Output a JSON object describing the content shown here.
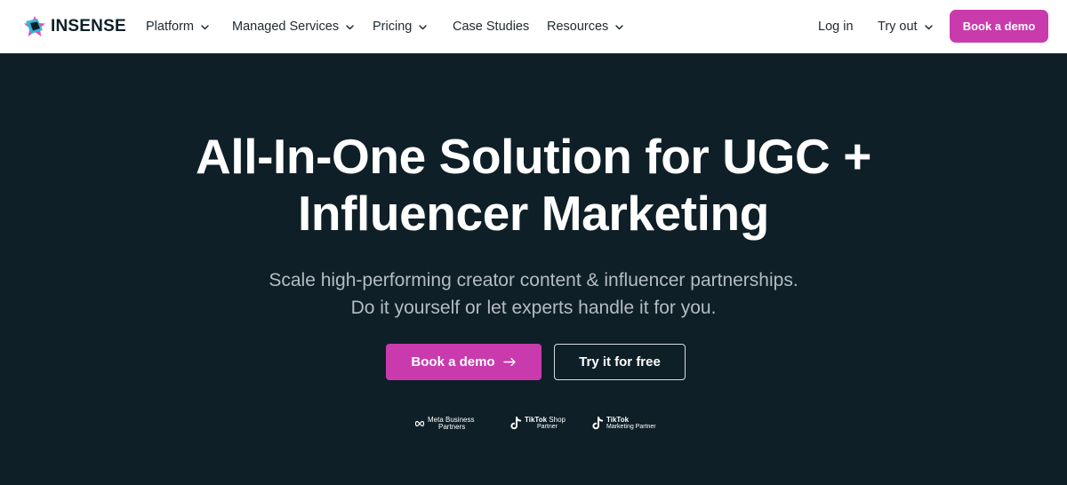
{
  "brand": {
    "name": "INSENSE",
    "colors": {
      "accent": "#c93aad",
      "dark_bg": "#0f1f27",
      "nav_bg": "#ffffff",
      "text_dark": "#1c2a32",
      "subtitle": "#b3bcc2"
    }
  },
  "nav": {
    "items": [
      {
        "label": "Platform",
        "dropdown": true
      },
      {
        "label": "Managed Services",
        "dropdown": true
      },
      {
        "label": "Pricing",
        "dropdown": true
      },
      {
        "label": "Case Studies",
        "dropdown": false
      },
      {
        "label": "Resources",
        "dropdown": true
      }
    ],
    "login_label": "Log in",
    "tryout_label": "Try out",
    "cta_label": "Book a demo"
  },
  "hero": {
    "title_line1": "All-In-One Solution for UGC +",
    "title_line2": "Influencer Marketing",
    "subtitle_line1": "Scale high-performing creator content & influencer partnerships.",
    "subtitle_line2": "Do it yourself or let experts handle it for you.",
    "primary_cta": "Book a demo",
    "primary_cta_icon": "arrow-right-icon",
    "secondary_cta": "Try it for free"
  },
  "partners": [
    {
      "icon": "meta-infinity-icon",
      "line1": "Meta Business",
      "line2": "Partners"
    },
    {
      "icon": "tiktok-icon",
      "line1_bold": "TikTok",
      "line1_rest": "Shop",
      "line2": "Partner"
    },
    {
      "icon": "tiktok-icon",
      "line1_bold": "TikTok",
      "line2": "Marketing Partner"
    }
  ]
}
